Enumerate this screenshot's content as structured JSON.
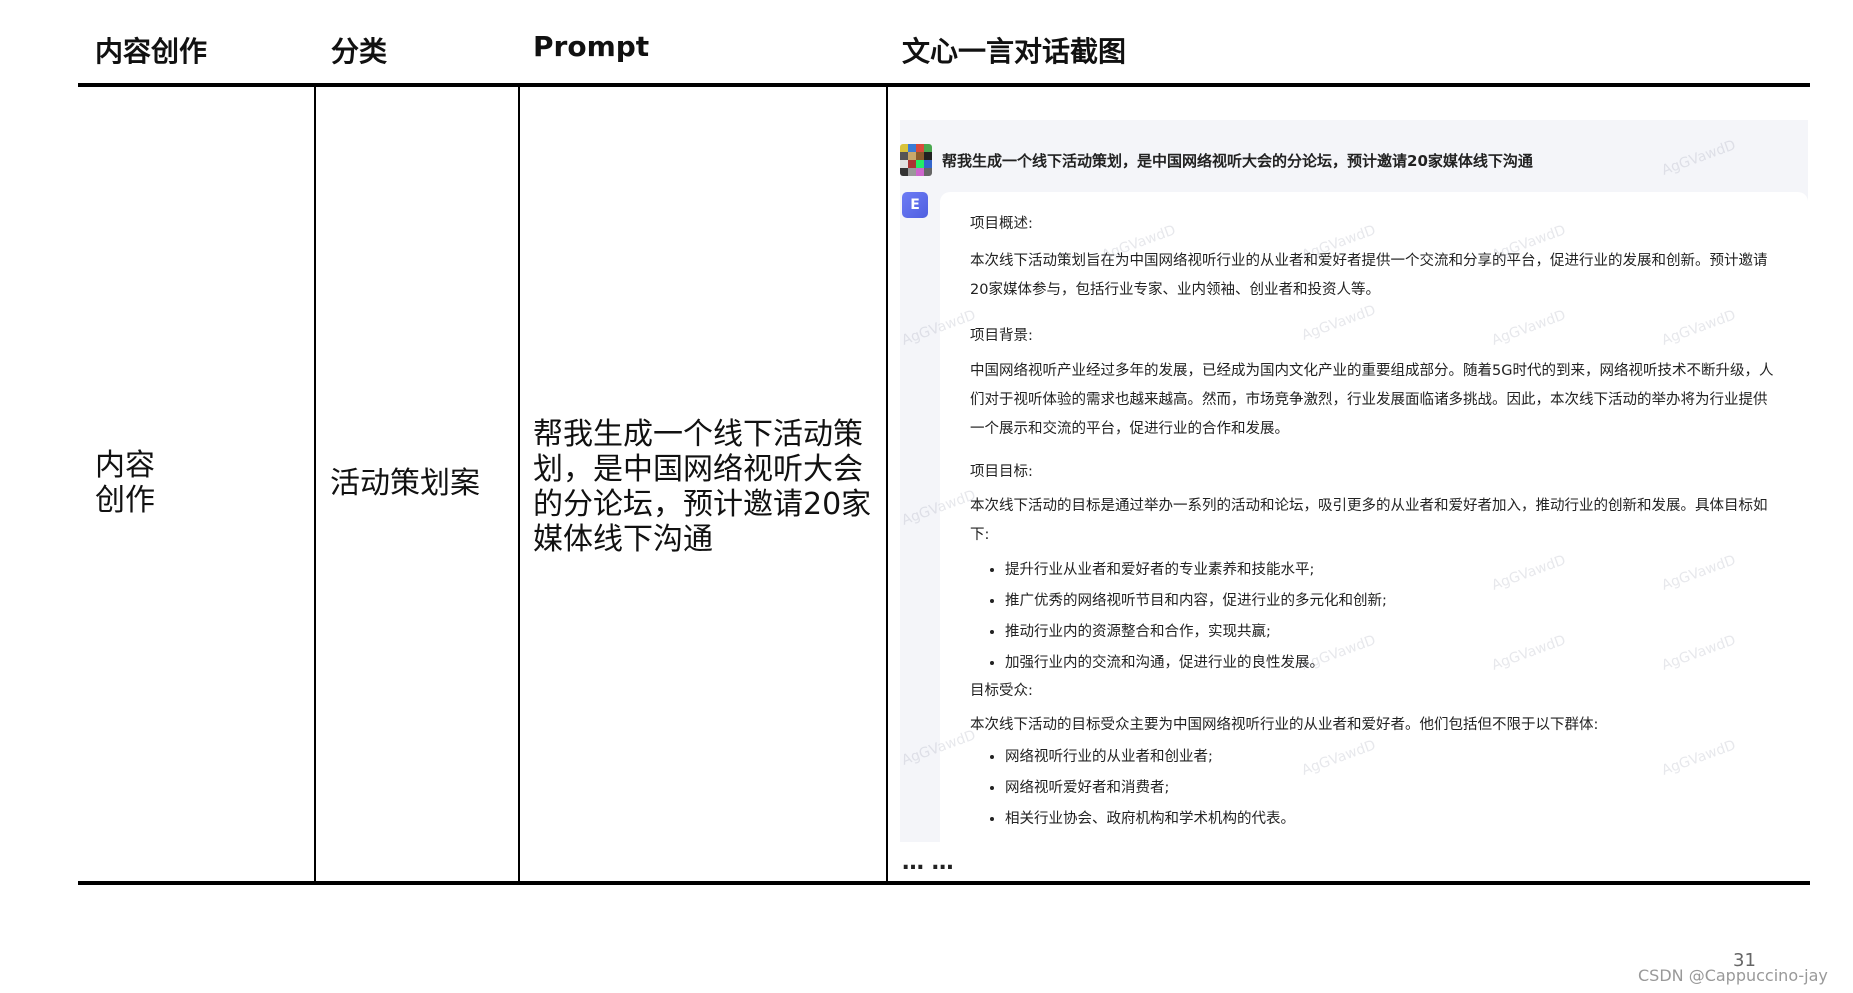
{
  "headers": {
    "col1": "内容创作",
    "col2": "分类",
    "col3": "Prompt",
    "col4": "文心一言对话截图"
  },
  "row": {
    "category_line1": "内容",
    "category_line2": "创作",
    "type": "活动策划案",
    "prompt": "帮我生成一个线下活动策划，是中国网络视听大会的分论坛，预计邀请20家媒体线下沟通"
  },
  "chat": {
    "question": "帮我生成一个线下活动策划，是中国网络视听大会的分论坛，预计邀请20家媒体线下沟通",
    "bot_avatar_letter": "E",
    "watermark": "AgGVawdD",
    "sections": {
      "overview_title": "项目概述:",
      "overview_text": "本次线下活动策划旨在为中国网络视听行业的从业者和爱好者提供一个交流和分享的平台，促进行业的发展和创新。预计邀请20家媒体参与，包括行业专家、业内领袖、创业者和投资人等。",
      "background_title": "项目背景:",
      "background_text": "中国网络视听产业经过多年的发展，已经成为国内文化产业的重要组成部分。随着5G时代的到来，网络视听技术不断升级，人们对于视听体验的需求也越来越高。然而，市场竞争激烈，行业发展面临诸多挑战。因此，本次线下活动的举办将为行业提供一个展示和交流的平台，促进行业的合作和发展。",
      "goal_title": "项目目标:",
      "goal_text": "本次线下活动的目标是通过举办一系列的活动和论坛，吸引更多的从业者和爱好者加入，推动行业的创新和发展。具体目标如下:",
      "goals": [
        "提升行业从业者和爱好者的专业素养和技能水平;",
        "推广优秀的网络视听节目和内容，促进行业的多元化和创新;",
        "推动行业内的资源整合和合作，实现共赢;",
        "加强行业内的交流和沟通，促进行业的良性发展。"
      ],
      "audience_title": "目标受众:",
      "audience_text": "本次线下活动的目标受众主要为中国网络视听行业的从业者和爱好者。他们包括但不限于以下群体:",
      "audiences": [
        "网络视听行业的从业者和创业者;",
        "网络视听爱好者和消费者;",
        "相关行业协会、政府机构和学术机构的代表。"
      ]
    }
  },
  "ellipsis": "… …",
  "page_number": "31",
  "credit": "CSDN @Cappuccino-jay"
}
